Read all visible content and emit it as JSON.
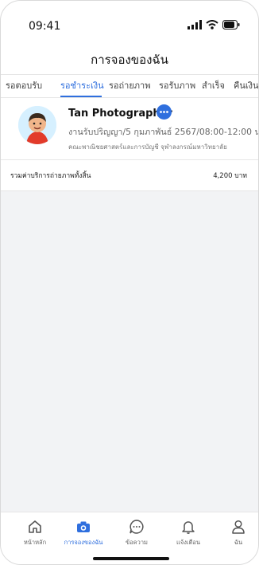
{
  "status_bar": {
    "time": "09:41"
  },
  "header": {
    "title": "การจองของฉัน"
  },
  "tabs": [
    {
      "label": "รอตอบรับ"
    },
    {
      "label": "รอชำระเงิน"
    },
    {
      "label": "รอถ่ายภาพ"
    },
    {
      "label": "รอรับภาพ"
    },
    {
      "label": "สำเร็จ"
    },
    {
      "label": "คืนเงิน"
    }
  ],
  "active_tab": "รอชำระเงิน",
  "booking": {
    "photographer_name": "Tan Photographer",
    "job_detail": "งานรับปริญญา/5 กุมภาพันธ์ 2567/08:00-12:00 น.",
    "faculty": "คณะพาณิชยศาสตร์และการบัญชี จุฬาลงกรณ์มหาวิทยาลัย"
  },
  "total": {
    "label": "รวมค่าบริการถ่ายภาพทั้งสิ้น",
    "value": "4,200 บาท"
  },
  "bottom_nav": [
    {
      "label": "หน้าหลัก",
      "icon": "home-icon"
    },
    {
      "label": "การจองของฉัน",
      "icon": "camera-icon"
    },
    {
      "label": "ข้อความ",
      "icon": "chat-icon"
    },
    {
      "label": "แจ้งเตือน",
      "icon": "bell-icon"
    },
    {
      "label": "ฉัน",
      "icon": "user-icon"
    }
  ],
  "colors": {
    "accent": "#2f6fde",
    "background": "#f2f3f5"
  }
}
